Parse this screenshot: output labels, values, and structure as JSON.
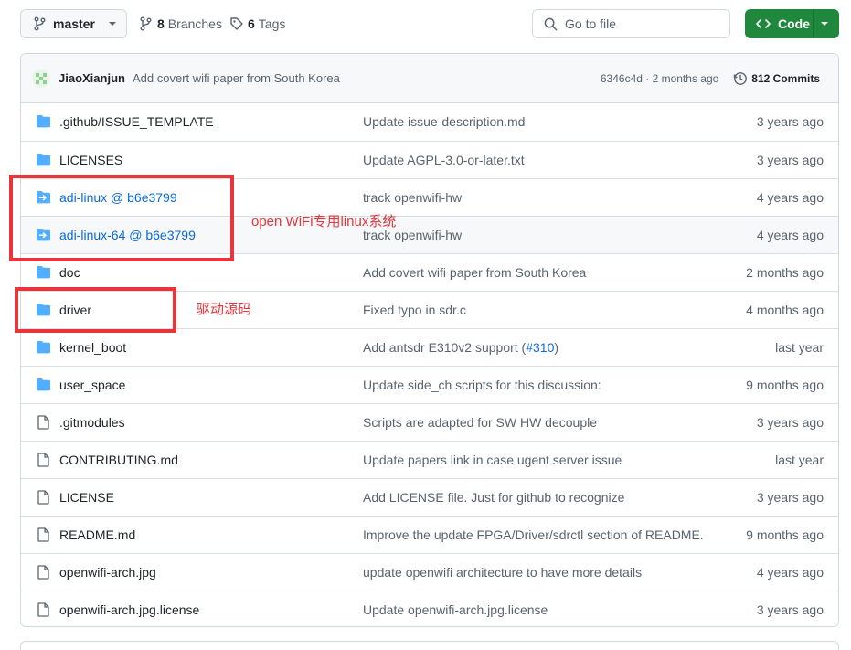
{
  "toolbar": {
    "branch": "master",
    "branches_count": "8",
    "branches_label": "Branches",
    "tags_count": "6",
    "tags_label": "Tags",
    "search_placeholder": "Go to file",
    "code_label": "Code"
  },
  "commit": {
    "author": "JiaoXianjun",
    "message": "Add covert wifi paper from South Korea",
    "hash_time": "6346c4d · 2 months ago",
    "commits_label": "812 Commits"
  },
  "files": [
    {
      "type": "folder",
      "name": "github-issue-template",
      "label": ".github/ISSUE_TEMPLATE",
      "msg": "Update issue-description.md",
      "time": "3 years ago"
    },
    {
      "type": "folder",
      "name": "licenses",
      "label": "LICENSES",
      "msg": "Update AGPL-3.0-or-later.txt",
      "time": "3 years ago"
    },
    {
      "type": "submodule",
      "name": "adi-linux",
      "label": "adi-linux @ b6e3799",
      "msg": "track openwifi-hw",
      "time": "4 years ago"
    },
    {
      "type": "submodule",
      "name": "adi-linux-64",
      "label": "adi-linux-64 @ b6e3799",
      "msg": "track openwifi-hw",
      "time": "4 years ago"
    },
    {
      "type": "folder",
      "name": "doc",
      "label": "doc",
      "msg": "Add covert wifi paper from South Korea",
      "time": "2 months ago"
    },
    {
      "type": "folder",
      "name": "driver",
      "label": "driver",
      "msg": "Fixed typo in sdr.c",
      "time": "4 months ago"
    },
    {
      "type": "folder",
      "name": "kernel-boot",
      "label": "kernel_boot",
      "msg": "Add antsdr E310v2 support (",
      "msg_link": "#310",
      "msg_tail": ")",
      "time": "last year"
    },
    {
      "type": "folder",
      "name": "user-space",
      "label": "user_space",
      "msg": "Update side_ch scripts for this discussion:",
      "time": "9 months ago"
    },
    {
      "type": "file",
      "name": "gitmodules",
      "label": ".gitmodules",
      "msg": "Scripts are adapted for SW HW decouple",
      "time": "3 years ago"
    },
    {
      "type": "file",
      "name": "contributing",
      "label": "CONTRIBUTING.md",
      "msg": "Update papers link in case ugent server issue",
      "time": "last year"
    },
    {
      "type": "file",
      "name": "license",
      "label": "LICENSE",
      "msg": "Add LICENSE file. Just for github to recognize",
      "time": "3 years ago"
    },
    {
      "type": "file",
      "name": "readme",
      "label": "README.md",
      "msg": "Improve the update FPGA/Driver/sdrctl section of README.",
      "time": "9 months ago"
    },
    {
      "type": "file",
      "name": "openwifi-arch-jpg",
      "label": "openwifi-arch.jpg",
      "msg": "update openwifi architecture to have more details",
      "time": "4 years ago"
    },
    {
      "type": "file",
      "name": "openwifi-arch-license",
      "label": "openwifi-arch.jpg.license",
      "msg": "Update openwifi-arch.jpg.license",
      "time": "3 years ago"
    }
  ],
  "annotations": {
    "linux_note": "open WiFi专用linux系统",
    "driver_note": "驱动源码",
    "color": "#e8353b"
  },
  "colors": {
    "accent_green": "#1f883d",
    "folder_blue": "#54aeff",
    "link_blue": "#0969da"
  }
}
